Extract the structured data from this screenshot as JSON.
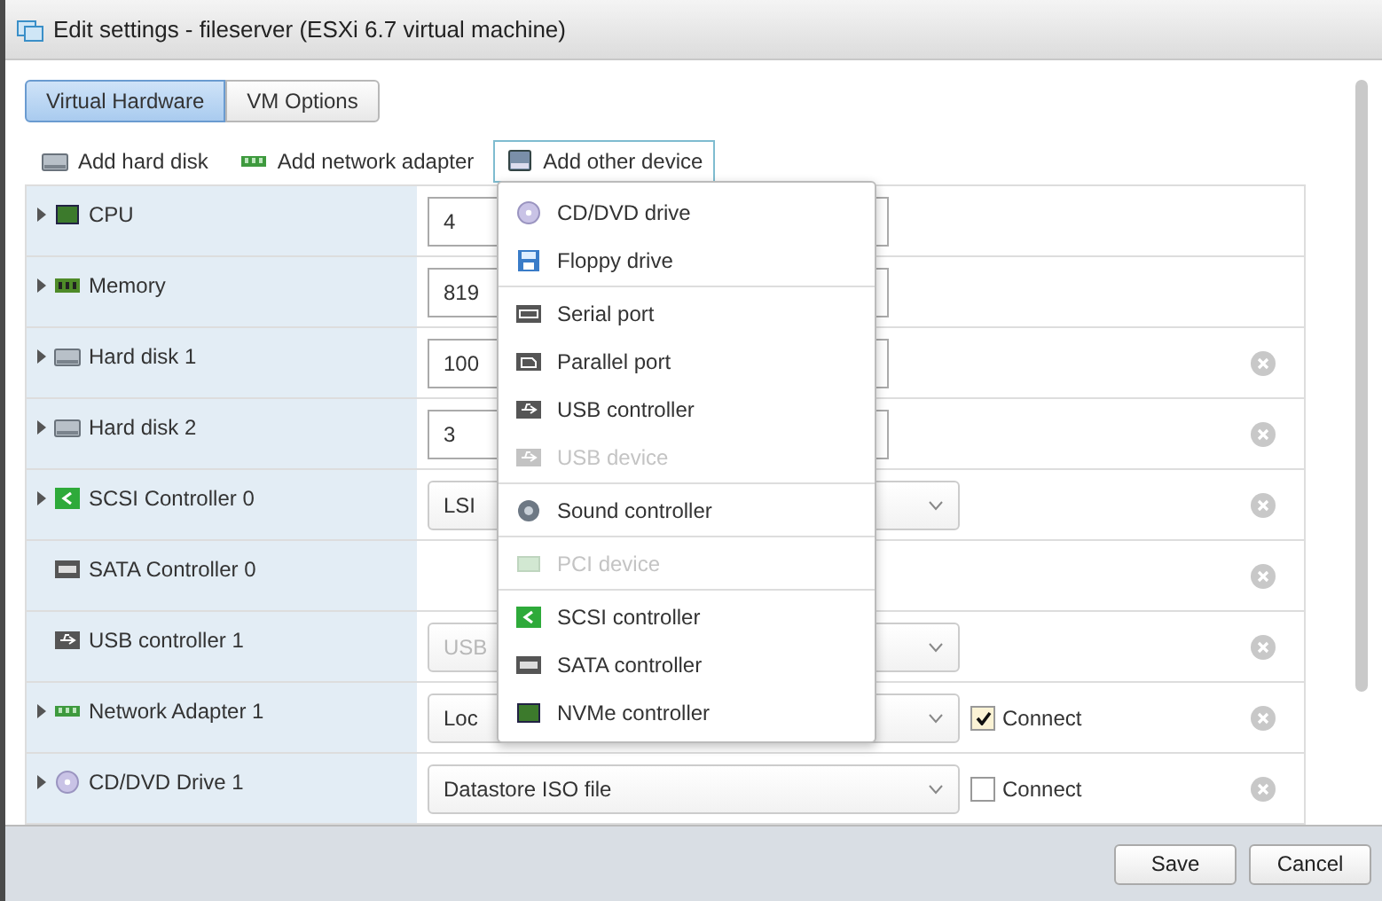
{
  "window": {
    "title": "Edit settings - fileserver (ESXi 6.7 virtual machine)"
  },
  "tabs": [
    {
      "label": "Virtual Hardware",
      "selected": true
    },
    {
      "label": "VM Options",
      "selected": false
    }
  ],
  "toolbar": [
    {
      "label": "Add hard disk",
      "expanded": false
    },
    {
      "label": "Add network adapter",
      "expanded": false
    },
    {
      "label": "Add other device",
      "expanded": true
    }
  ],
  "device_menu": {
    "groups": [
      [
        {
          "label": "CD/DVD drive",
          "disabled": false
        },
        {
          "label": "Floppy drive",
          "disabled": false
        }
      ],
      [
        {
          "label": "Serial port",
          "disabled": false
        },
        {
          "label": "Parallel port",
          "disabled": false
        },
        {
          "label": "USB controller",
          "disabled": false
        },
        {
          "label": "USB device",
          "disabled": true
        }
      ],
      [
        {
          "label": "Sound controller",
          "disabled": false
        }
      ],
      [
        {
          "label": "PCI device",
          "disabled": true
        }
      ],
      [
        {
          "label": "SCSI controller",
          "disabled": false
        },
        {
          "label": "SATA controller",
          "disabled": false
        },
        {
          "label": "NVMe controller",
          "disabled": false
        }
      ]
    ]
  },
  "devices": [
    {
      "name": "CPU",
      "expanded": false,
      "kind": "input",
      "value": "4",
      "removable": false
    },
    {
      "name": "Memory",
      "expanded": false,
      "kind": "input",
      "value": "819",
      "removable": false
    },
    {
      "name": "Hard disk 1",
      "expanded": false,
      "kind": "input",
      "value": "100",
      "removable": true
    },
    {
      "name": "Hard disk 2",
      "expanded": false,
      "kind": "input",
      "value": "3",
      "removable": true
    },
    {
      "name": "SCSI Controller 0",
      "expanded": false,
      "kind": "select",
      "value": "LSI",
      "disabled": false,
      "removable": true
    },
    {
      "name": "SATA Controller 0",
      "kind": "none",
      "removable": true
    },
    {
      "name": "USB controller 1",
      "kind": "select",
      "value": "USB",
      "disabled": true,
      "removable": true
    },
    {
      "name": "Network Adapter 1",
      "expanded": false,
      "kind": "select",
      "value": "Loc",
      "disabled": false,
      "connect": {
        "label": "Connect",
        "checked": true
      },
      "removable": true
    },
    {
      "name": "CD/DVD Drive 1",
      "expanded": false,
      "kind": "select",
      "value": "Datastore ISO file",
      "disabled": false,
      "connect": {
        "label": "Connect",
        "checked": false
      },
      "removable": true
    }
  ],
  "buttons": [
    {
      "label": "Save"
    },
    {
      "label": "Cancel"
    }
  ]
}
